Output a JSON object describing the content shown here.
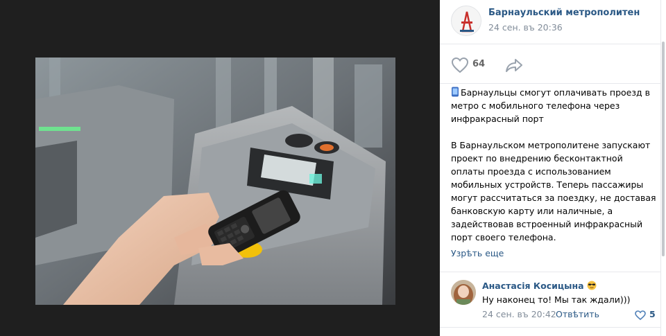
{
  "post": {
    "group_name": "Барнаульский метрополитен",
    "date": "24 сен. въ 20:36",
    "like_count": "64",
    "headline": "Барнаульцы смогут оплачивать проезд в метро с мобильного телефона через инфракрасный порт",
    "body": "В Барнаульском метрополитене запускают проект по внедрению бесконтактной оплаты проезда с использованием мобильных устройств. Теперь пассажиры могут рассчитаться за поездку, не доставая банковскую карту или наличные, а задействовав встроенный инфракрасный порт своего телефона.",
    "more_label": "Узрѣть еще"
  },
  "comment": {
    "author": "Анастасія Косицына",
    "text": "Ну наконец то! Мы так ждали)))",
    "date": "24 сен. въ 20:42",
    "reply_label": "Отвѣтить",
    "like_count": "5"
  },
  "icons": {
    "like": "heart-outline-icon",
    "share": "share-arrow-icon",
    "phone": "mobile-phone-emoji",
    "cool": "sunglasses-emoji",
    "comment_like": "heart-outline-icon"
  },
  "colors": {
    "link": "#2a5885",
    "muted": "#818c99",
    "viewer_bg": "#1f1f1f"
  }
}
